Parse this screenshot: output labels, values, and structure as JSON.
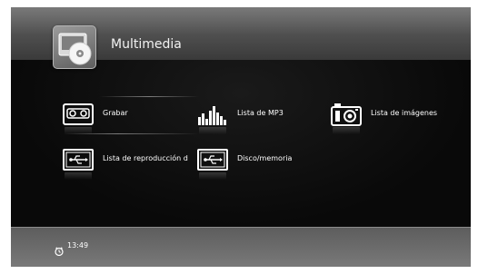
{
  "header": {
    "title": "Multimedia",
    "icon": "multimedia-disc-icon"
  },
  "menu": {
    "items": [
      {
        "label": "Grabar",
        "icon": "cassette-icon",
        "selected": true
      },
      {
        "label": "Lista de MP3",
        "icon": "equalizer-icon",
        "selected": false
      },
      {
        "label": "Lista de imágenes",
        "icon": "camera-icon",
        "selected": false
      },
      {
        "label": "Lista de reproducción d",
        "icon": "usb-icon",
        "selected": false
      },
      {
        "label": "Disco/memoria",
        "icon": "usb-icon",
        "selected": false
      }
    ]
  },
  "footer": {
    "time": "13:49",
    "icon": "clock-icon"
  }
}
